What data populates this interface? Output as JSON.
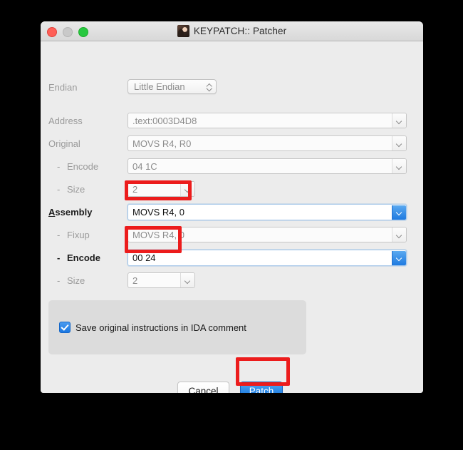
{
  "window": {
    "title": "KEYPATCH:: Patcher",
    "icon": "keypatch-logo-icon",
    "traffic_lights": {
      "close": "close-window-button",
      "minimize": "minimize-window-button",
      "maximize": "maximize-window-button"
    }
  },
  "form": {
    "endian": {
      "label": "Endian",
      "value": "Little Endian"
    },
    "address": {
      "label": "Address",
      "value": ".text:0003D4D8"
    },
    "original": {
      "label": "Original",
      "value": "MOVS R4, R0"
    },
    "original_encode": {
      "label": "Encode",
      "dash": "-",
      "value": "04 1C"
    },
    "original_size": {
      "label": "Size",
      "dash": "-",
      "value": "2"
    },
    "assembly": {
      "label_mnemonic": "A",
      "label_rest": "ssembly",
      "value": "MOVS R4, 0"
    },
    "fixup": {
      "label": "Fixup",
      "dash": "-",
      "value": "MOVS R4, 0"
    },
    "new_encode": {
      "label": "Encode",
      "dash": "-",
      "value": "00 24"
    },
    "new_size": {
      "label": "Size",
      "dash": "-",
      "value": "2"
    }
  },
  "options": {
    "save_original_comment": {
      "label": "Save original instructions in IDA comment",
      "checked": true
    }
  },
  "buttons": {
    "cancel": "Cancel",
    "patch": "Patch"
  },
  "annotations": {
    "highlight_color": "#ec1c1c",
    "targets": [
      "assembly-value",
      "new-encode-value",
      "patch-button"
    ]
  },
  "colors": {
    "window_background": "#ececec",
    "groupbox": "#dcdcdc",
    "accent_blue": "#1f7ae0",
    "page_background": "#000000"
  }
}
